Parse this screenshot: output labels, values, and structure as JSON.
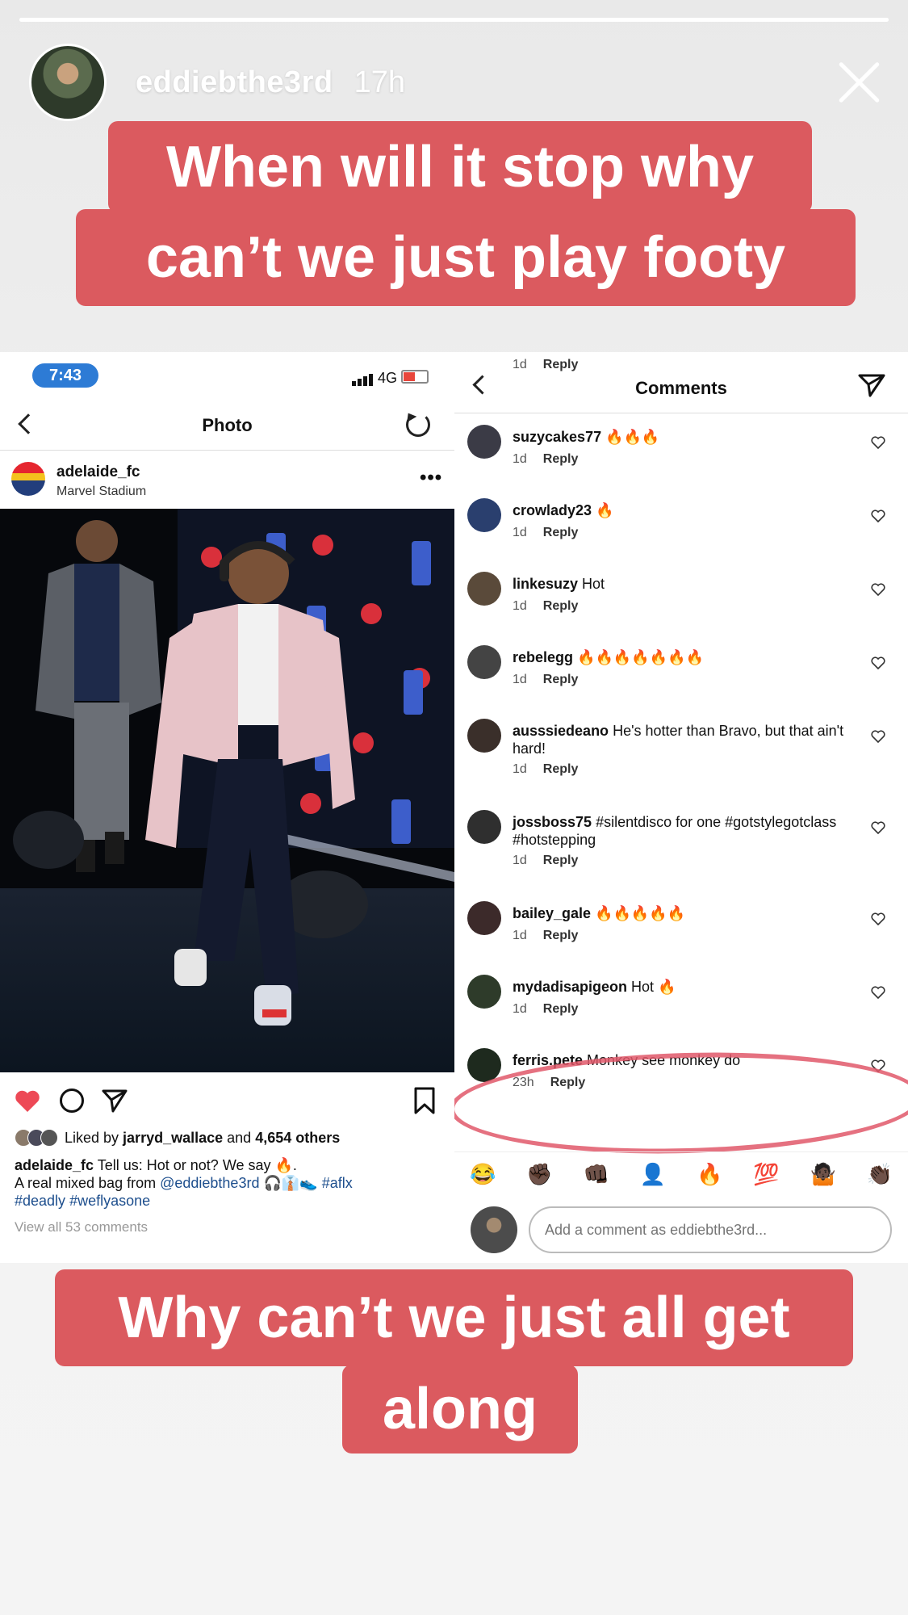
{
  "story": {
    "username": "eddiebthe3rd",
    "time": "17h",
    "caption_top_line1": "When will it stop why",
    "caption_top_line2": "can’t we just play footy",
    "caption_bottom_line1": "Why can’t we just all get",
    "caption_bottom_line2": "along",
    "accent_color": "#db5a5f"
  },
  "left": {
    "status_time": "7:43",
    "network": "4G",
    "nav_title": "Photo",
    "post_user": "adelaide_fc",
    "post_location": "Marvel Stadium",
    "more": "•••",
    "liked_by_prefix": "Liked by ",
    "liked_by_user": "jarryd_wallace",
    "liked_by_suffix": " and ",
    "liked_by_count": "4,654 others",
    "caption_user": "adelaide_fc",
    "caption_text": " Tell us: Hot or not? We say 🔥.",
    "caption_line2_prefix": "A real mixed bag from ",
    "caption_mention": "@eddiebthe3rd",
    "caption_emojis": " 🎧👔👟 ",
    "caption_tag1": "#aflx",
    "caption_tag2": "#deadly",
    "caption_tag3": "#weflyasone",
    "view_all": "View all 53 comments"
  },
  "right": {
    "nav_title": "Comments",
    "comments": [
      {
        "user": "",
        "text": "",
        "age": "1d",
        "reply": "Reply"
      },
      {
        "user": "suzycakes77",
        "text": " 🔥🔥🔥",
        "age": "1d",
        "reply": "Reply"
      },
      {
        "user": "crowlady23",
        "text": " 🔥",
        "age": "1d",
        "reply": "Reply"
      },
      {
        "user": "linkesuzy",
        "text": " Hot",
        "age": "1d",
        "reply": "Reply"
      },
      {
        "user": "rebelegg",
        "text": " 🔥🔥🔥🔥🔥🔥🔥",
        "age": "1d",
        "reply": "Reply"
      },
      {
        "user": "ausssiedeano",
        "text": " He's hotter than Bravo, but that ain't hard!",
        "age": "1d",
        "reply": "Reply"
      },
      {
        "user": "jossboss75",
        "text": " #silentdisco for one #gotstylegotclass #hotstepping",
        "age": "1d",
        "reply": "Reply"
      },
      {
        "user": "bailey_gale",
        "text": " 🔥🔥🔥🔥🔥",
        "age": "1d",
        "reply": "Reply"
      },
      {
        "user": "mydadisapigeon",
        "text": " Hot 🔥",
        "age": "1d",
        "reply": "Reply"
      },
      {
        "user": "ferris.pete",
        "text": " Monkey see monkey do",
        "age": "23h",
        "reply": "Reply"
      }
    ],
    "emojis": [
      "😂",
      "✊🏿",
      "👊🏿",
      "👤",
      "🔥",
      "💯",
      "🤷🏿",
      "👏🏿"
    ],
    "add_comment_placeholder": "Add a comment as eddiebthe3rd..."
  }
}
